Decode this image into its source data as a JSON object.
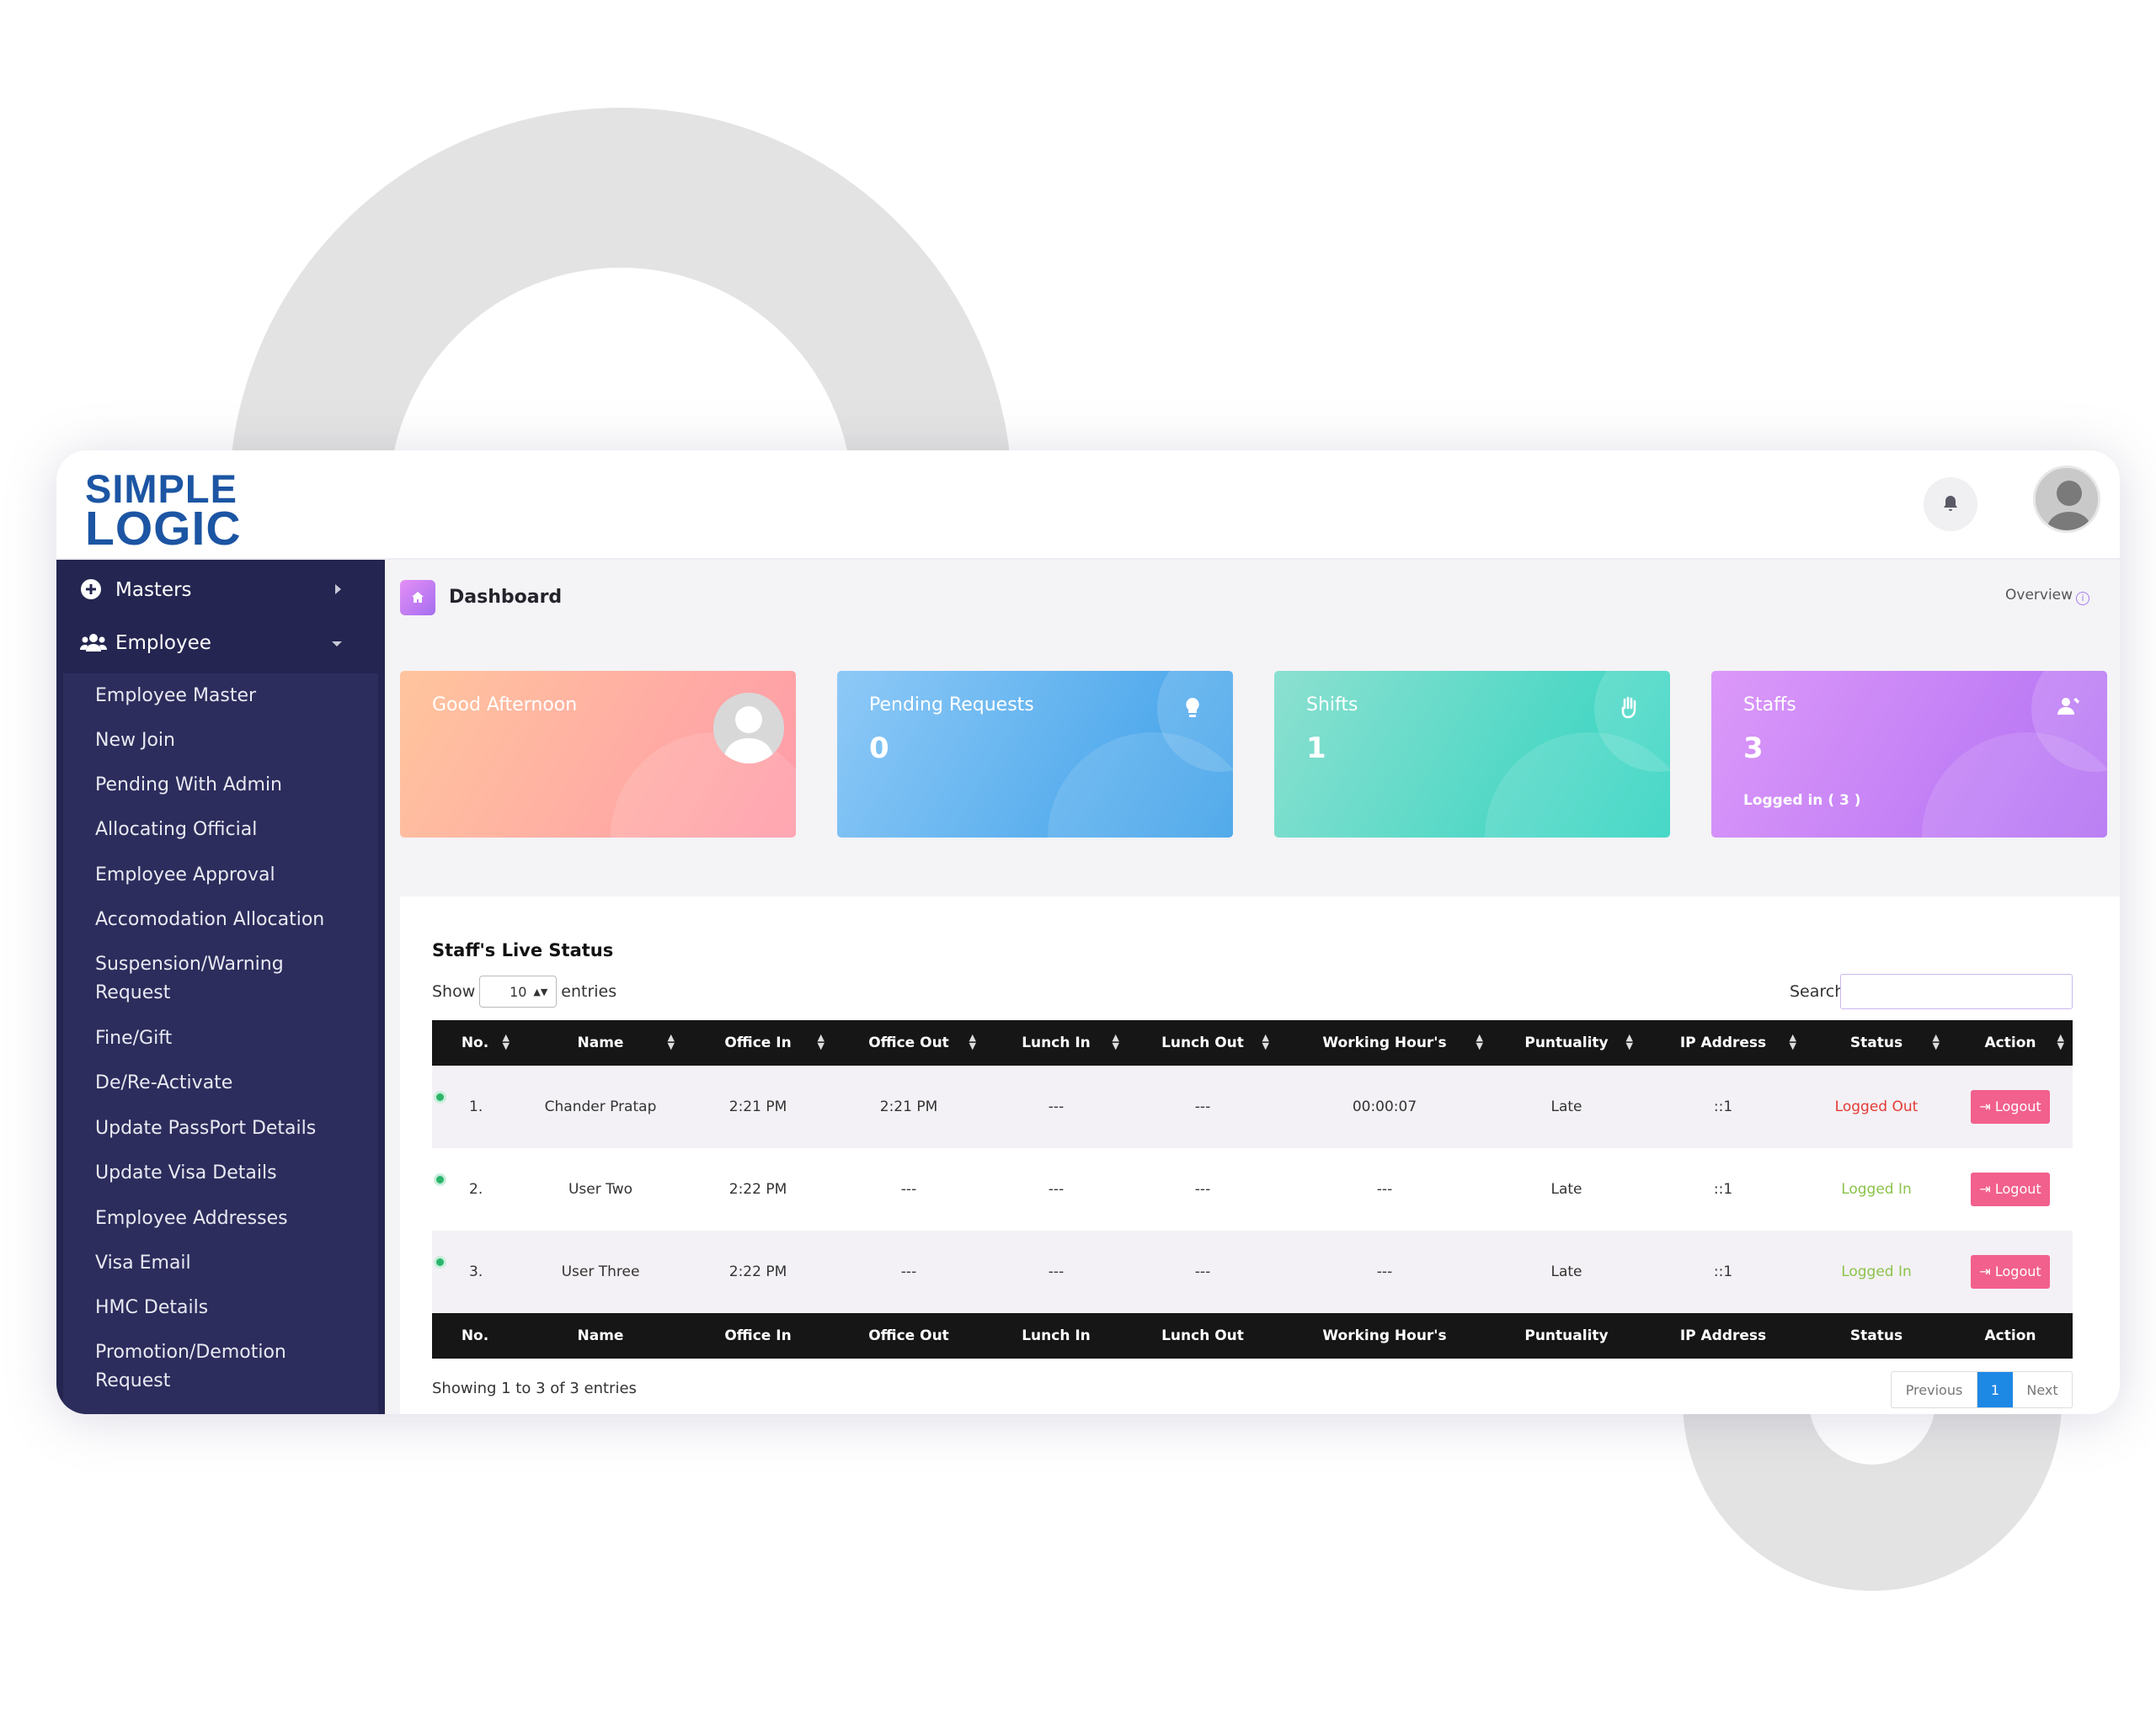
{
  "brand": {
    "line1": "SIMPLE",
    "line2": "LOGIC",
    "color": "#1c55a3"
  },
  "header": {
    "notification_icon": "bell-icon",
    "avatar_icon": "user-avatar-icon"
  },
  "sidebar": {
    "sections": [
      {
        "label": "Masters",
        "icon": "plus-circle-icon",
        "expanded": false
      },
      {
        "label": "Employee",
        "icon": "users-icon",
        "expanded": true
      }
    ],
    "items": [
      "Employee Master",
      "New Join",
      "Pending With Admin",
      "Allocating Official",
      "Employee Approval",
      "Accomodation Allocation",
      "Suspension/Warning Request",
      "Fine/Gift",
      "De/Re-Activate",
      "Update PassPort Details",
      "Update Visa Details",
      "Employee Addresses",
      "Visa Email",
      "HMC Details",
      "Promotion/Demotion Request"
    ]
  },
  "breadcrumb": {
    "title": "Dashboard",
    "right": "Overview"
  },
  "cards": [
    {
      "title": "Good Afternoon",
      "value": "",
      "sub": "",
      "icon": "user-avatar-icon"
    },
    {
      "title": "Pending Requests",
      "value": "0",
      "sub": "",
      "icon": "lightbulb-icon"
    },
    {
      "title": "Shifts",
      "value": "1",
      "sub": "",
      "icon": "hand-icon"
    },
    {
      "title": "Staffs",
      "value": "3",
      "sub": "Logged in ( 3 )",
      "icon": "user-phone-icon"
    }
  ],
  "live_status": {
    "title": "Staff's Live Status",
    "show_label": "Show",
    "entries_value": "10",
    "entries_label": "entries",
    "search_label": "Search:",
    "search_value": "",
    "columns": [
      "No.",
      "Name",
      "Office In",
      "Office Out",
      "Lunch In",
      "Lunch Out",
      "Working Hour's",
      "Puntuality",
      "IP Address",
      "Status",
      "Action"
    ],
    "rows": [
      {
        "no": "1.",
        "name": "Chander Pratap",
        "office_in": "2:21 PM",
        "office_out": "2:21 PM",
        "lunch_in": "---",
        "lunch_out": "---",
        "working": "00:00:07",
        "punctuality": "Late",
        "ip": "::1",
        "status": "Logged Out",
        "action": "Logout"
      },
      {
        "no": "2.",
        "name": "User Two",
        "office_in": "2:22 PM",
        "office_out": "---",
        "lunch_in": "---",
        "lunch_out": "---",
        "working": "---",
        "punctuality": "Late",
        "ip": "::1",
        "status": "Logged In",
        "action": "Logout"
      },
      {
        "no": "3.",
        "name": "User Three",
        "office_in": "2:22 PM",
        "office_out": "---",
        "lunch_in": "---",
        "lunch_out": "---",
        "working": "---",
        "punctuality": "Late",
        "ip": "::1",
        "status": "Logged In",
        "action": "Logout"
      }
    ],
    "showing": "Showing 1 to 3 of 3 entries",
    "pagination": {
      "previous": "Previous",
      "current": "1",
      "next": "Next"
    }
  },
  "colors": {
    "sidebar": "#242550",
    "logged_out": "#e53935",
    "logged_in": "#8bc34a",
    "logout_button": "#f2608d",
    "pager_active": "#1e88e5"
  }
}
